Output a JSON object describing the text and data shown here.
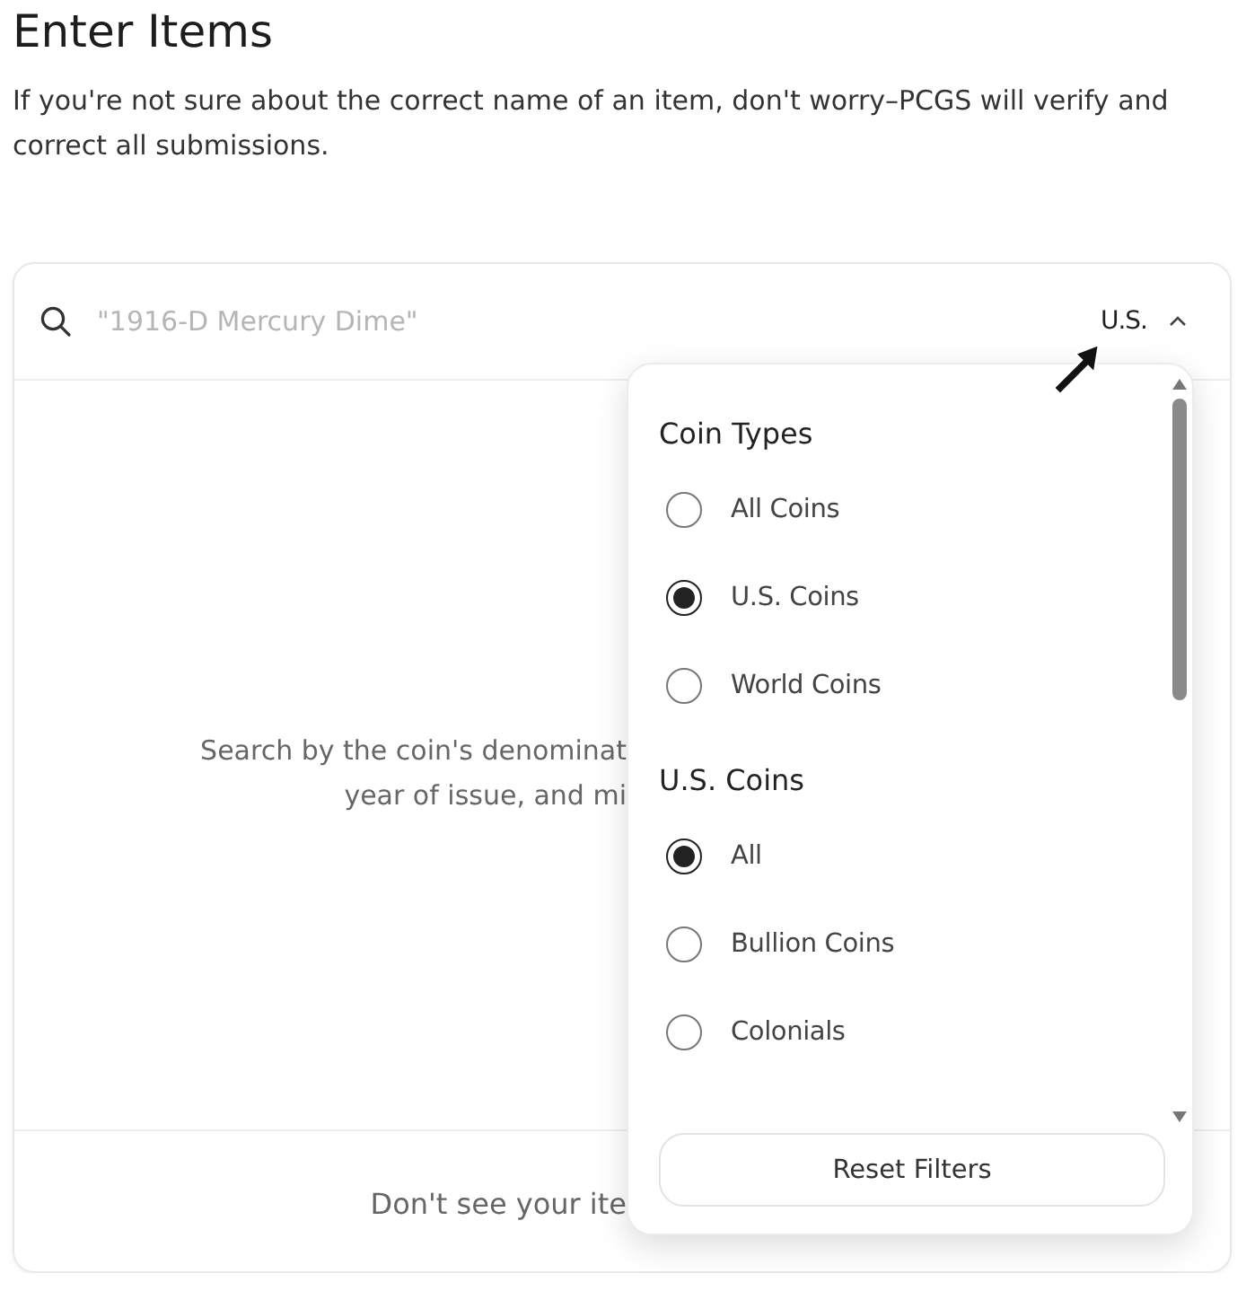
{
  "title": "Enter Items",
  "intro": "If you're not sure about the correct name of an item, don't worry–PCGS will verify and correct all submissions.",
  "search": {
    "placeholder": "\"1916-D Mercury Dime\"",
    "filter_label": "U.S.",
    "expanded": true
  },
  "empty_message": [
    "Search by the coin's denominat",
    "year of issue, and mi"
  ],
  "footer_text": "Don't see your ite",
  "filter_menu": {
    "groups": [
      {
        "heading": "Coin Types",
        "options": [
          {
            "label": "All Coins",
            "selected": false
          },
          {
            "label": "U.S. Coins",
            "selected": true
          },
          {
            "label": "World Coins",
            "selected": false
          }
        ]
      },
      {
        "heading": "U.S. Coins",
        "options": [
          {
            "label": "All",
            "selected": true
          },
          {
            "label": "Bullion Coins",
            "selected": false
          },
          {
            "label": "Colonials",
            "selected": false
          }
        ]
      }
    ],
    "reset_button": "Reset Filters"
  }
}
